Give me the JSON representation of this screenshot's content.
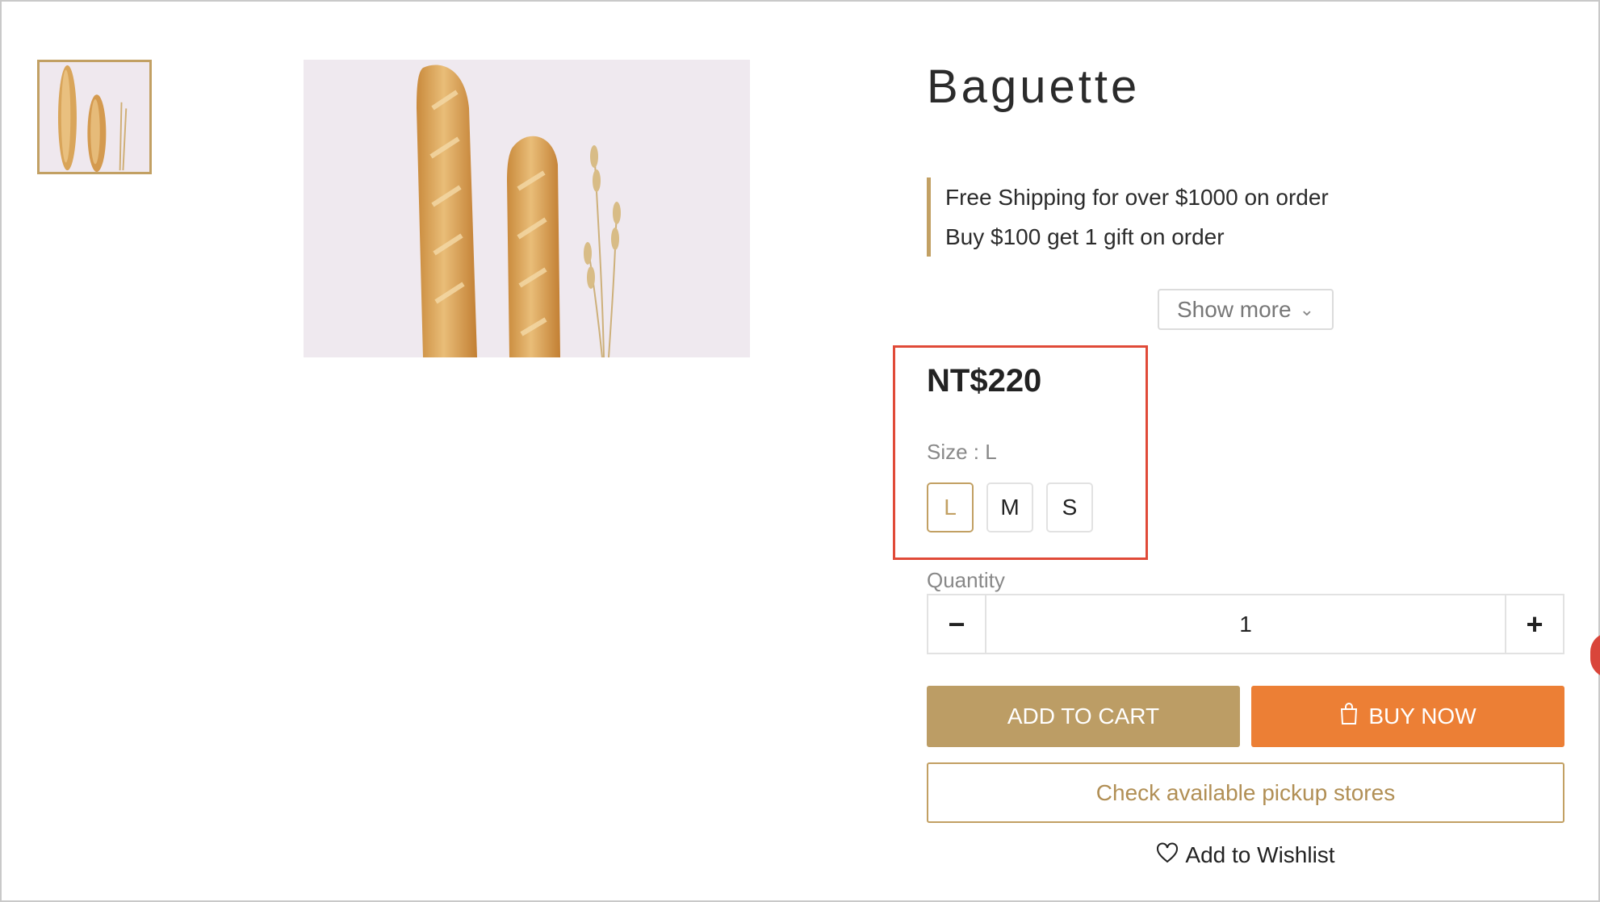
{
  "product": {
    "title": "Baguette",
    "promos": [
      "Free Shipping for over $1000 on order",
      "Buy $100 get 1 gift on order"
    ],
    "show_more_label": "Show more",
    "price": "NT$220",
    "size_label": "Size : L",
    "sizes": [
      "L",
      "M",
      "S"
    ],
    "selected_size": "L",
    "quantity_label": "Quantity",
    "quantity_value": "1"
  },
  "actions": {
    "add_to_cart": "ADD TO CART",
    "buy_now": "BUY NOW",
    "pickup": "Check available pickup stores",
    "wishlist": "Add to Wishlist"
  },
  "icons": {
    "chevron": "chevron-down-icon",
    "bag": "shopping-bag-icon",
    "heart": "heart-icon",
    "minus": "minus-icon",
    "plus": "plus-icon"
  },
  "colors": {
    "accent_gold": "#bc9d65",
    "buy_orange": "#ec7f35",
    "highlight_red": "#e04a38"
  }
}
